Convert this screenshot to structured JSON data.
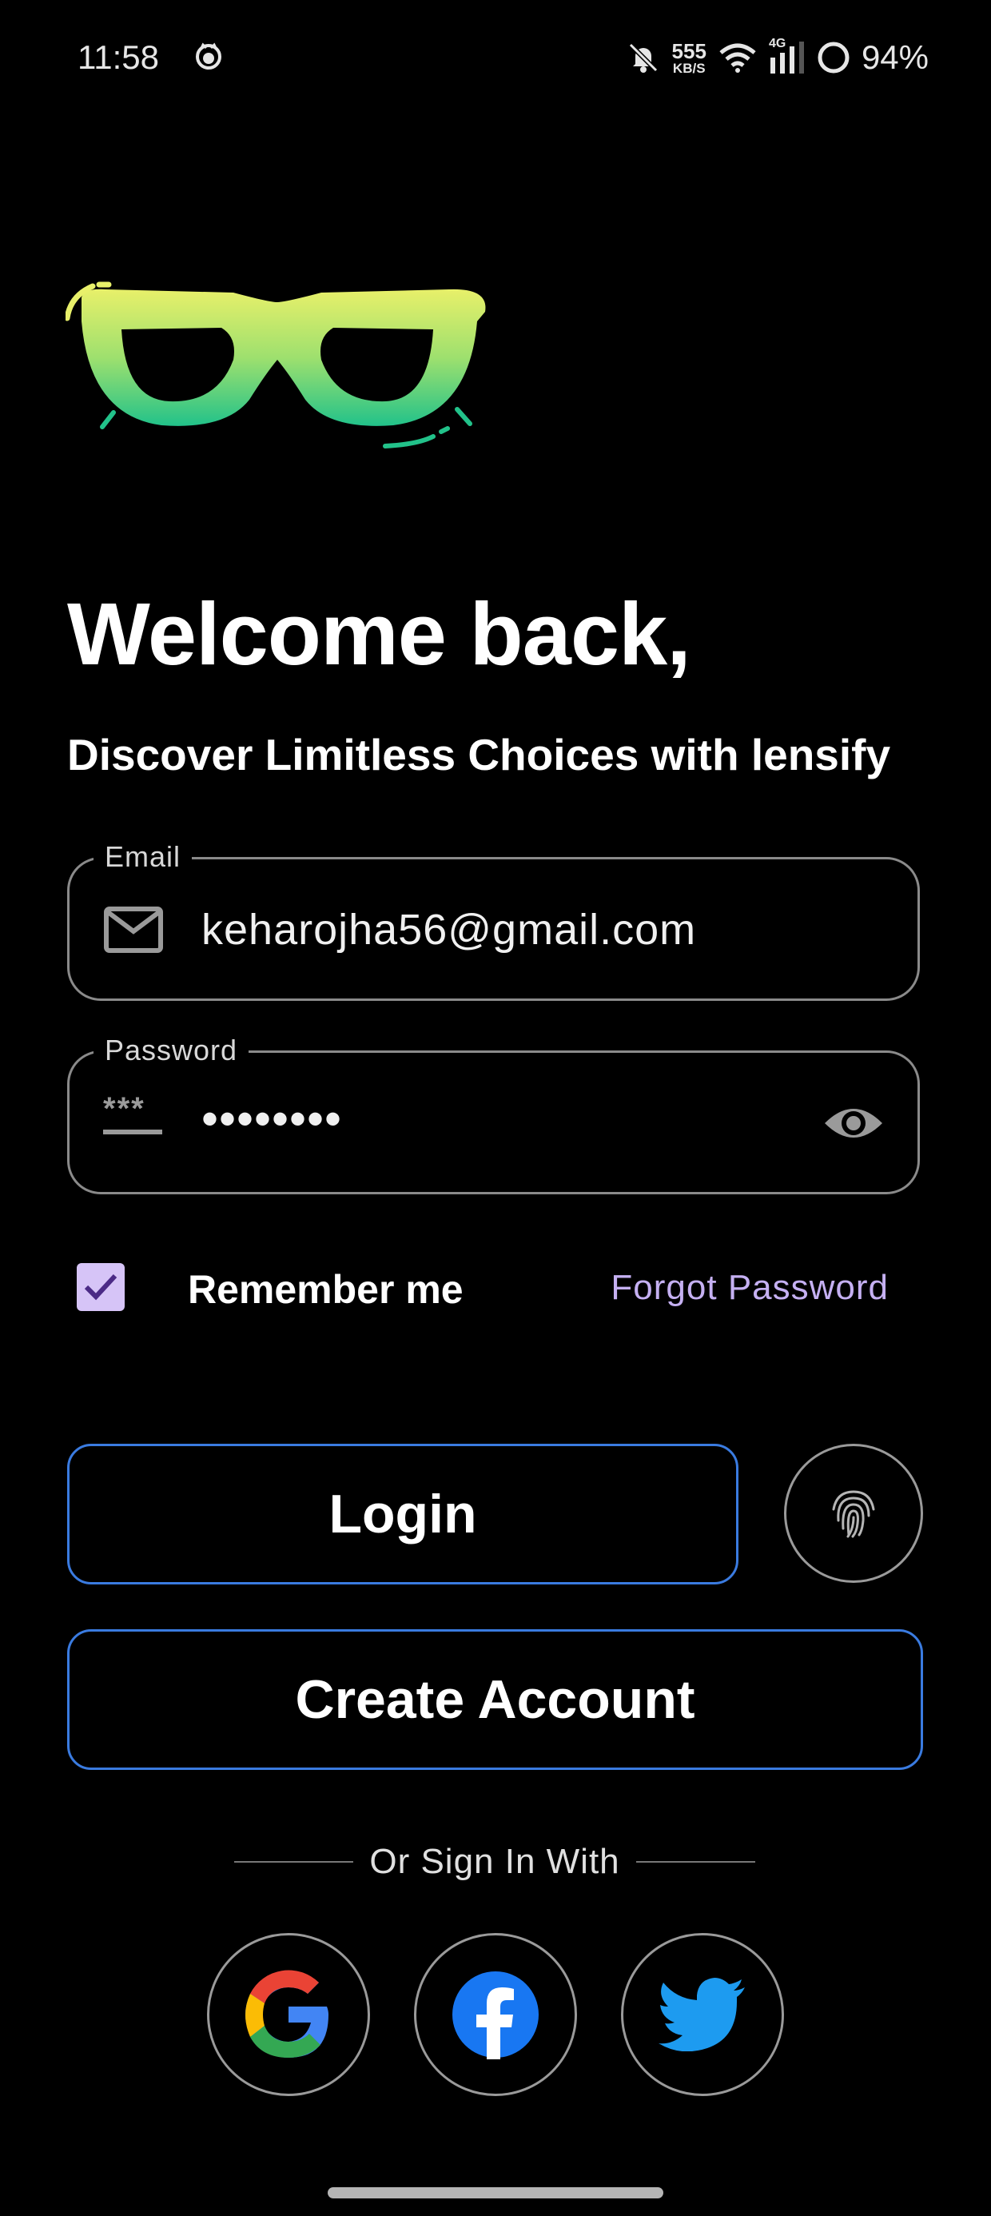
{
  "status_bar": {
    "time": "11:58",
    "net_speed_value": "555",
    "net_speed_unit": "KB/S",
    "network_type": "4G",
    "battery": "94%"
  },
  "header": {
    "title": "Welcome back,",
    "subtitle": "Discover Limitless Choices with lensify"
  },
  "form": {
    "email": {
      "label": "Email",
      "value": "keharojha56@gmail.com"
    },
    "password": {
      "label": "Password",
      "masked_value": "••••••••",
      "icon_text": "***"
    },
    "remember_me": {
      "label": "Remember me",
      "checked": true
    },
    "forgot_password": "Forgot Password"
  },
  "actions": {
    "login": "Login",
    "create_account": "Create Account"
  },
  "social": {
    "divider_text": "Or Sign In With",
    "providers": [
      "google",
      "facebook",
      "twitter"
    ]
  },
  "colors": {
    "background": "#000000",
    "button_border": "#3a7be0",
    "accent_purple": "#c5b0f2",
    "checkbox_fill": "#d6c4f7"
  },
  "icons": [
    "cat-icon",
    "mute-icon",
    "wifi-icon",
    "signal-icon",
    "battery-icon",
    "email-icon",
    "password-icon",
    "eye-icon",
    "check-icon",
    "fingerprint-icon",
    "google-icon",
    "facebook-icon",
    "twitter-icon"
  ]
}
